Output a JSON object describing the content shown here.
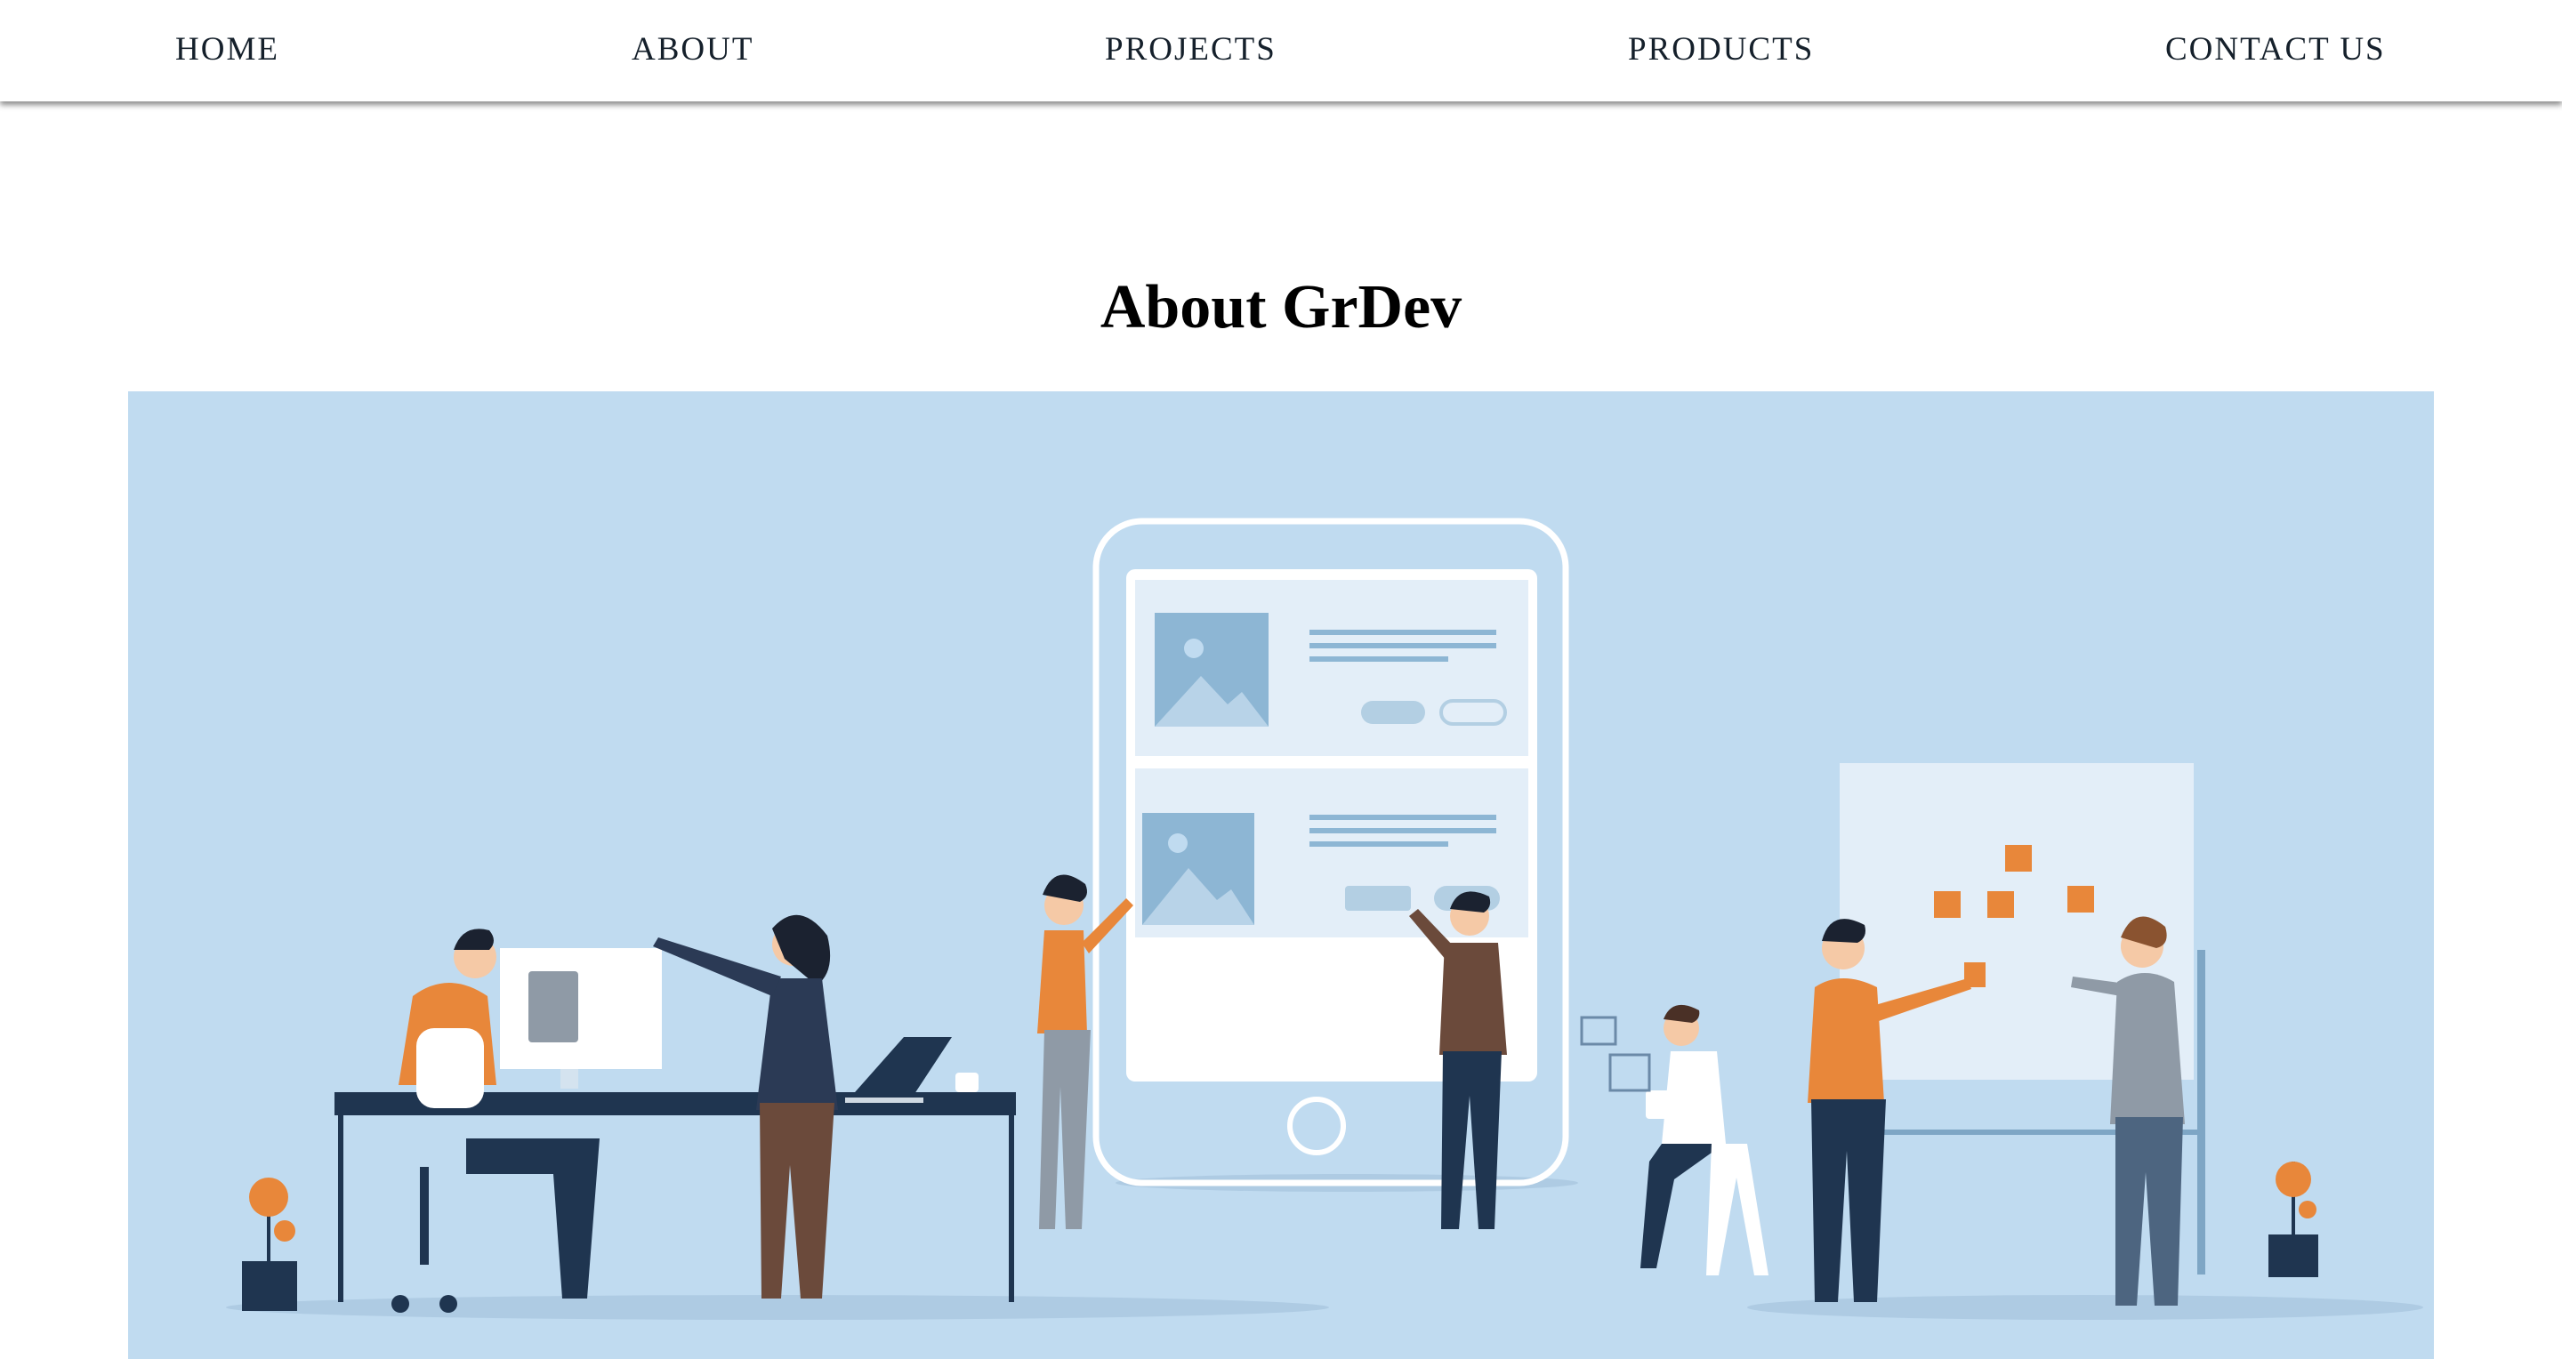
{
  "nav": {
    "items": [
      {
        "label": "HOME"
      },
      {
        "label": "ABOUT"
      },
      {
        "label": "PROJECTS"
      },
      {
        "label": "PRODUCTS"
      },
      {
        "label": "CONTACT US"
      }
    ]
  },
  "main": {
    "title": "About GrDev"
  },
  "colors": {
    "nav_text": "#15202b",
    "hero_background": "#c0dbf0",
    "accent_orange": "#e8873a",
    "navy": "#1f3550"
  }
}
